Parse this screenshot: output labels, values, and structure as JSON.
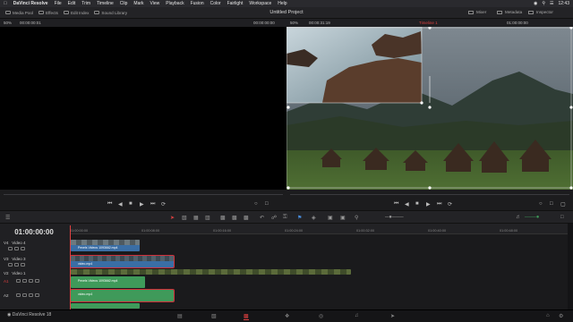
{
  "menubar": {
    "app": "DaVinci Resolve",
    "items": [
      "File",
      "Edit",
      "Trim",
      "Timeline",
      "Clip",
      "Mark",
      "View",
      "Playback",
      "Fusion",
      "Color",
      "Fairlight",
      "Workspace",
      "Help"
    ],
    "clock": "12:43"
  },
  "toolbar": {
    "media_pool": "Media Pool",
    "effects": "Effects",
    "edit_index": "Edit Index",
    "sound_library": "Sound Library",
    "project_title": "Untitled Project",
    "mixer": "Mixer",
    "metadata": "Metadata",
    "inspector": "Inspector"
  },
  "source_viewer": {
    "zoom": "50%",
    "timecode": "00:00:00:01",
    "duration": "00:00:00:00"
  },
  "program_viewer": {
    "zoom": "50%",
    "duration": "00:00:31:19",
    "timeline_name": "Timeline 1",
    "timecode": "01:00:00:00"
  },
  "timeline": {
    "timecode": "01:00:00:00",
    "ruler_ticks": [
      "01:00:00:00",
      "01:00:08:00",
      "01:00:16:00",
      "01:00:24:00",
      "01:00:32:00",
      "01:00:40:00",
      "01:00:48:00"
    ],
    "tracks": [
      {
        "id": "V4",
        "name": "Video 4"
      },
      {
        "id": "V3",
        "name": "Video 3"
      },
      {
        "id": "V2",
        "name": ""
      },
      {
        "id": "V1",
        "name": "Video 1"
      },
      {
        "id": "A1",
        "name": "A1"
      },
      {
        "id": "A2",
        "name": "A2"
      },
      {
        "id": "A3",
        "name": ""
      }
    ],
    "clips": {
      "v4": "Pexels Videos 1093662.mp4",
      "v3": "video.mp4",
      "a1": "Pexels Videos 1093662.mp4",
      "a2": "video.mp4"
    }
  },
  "pages_bar": {
    "app_label": "DaVinci Resolve 18"
  }
}
